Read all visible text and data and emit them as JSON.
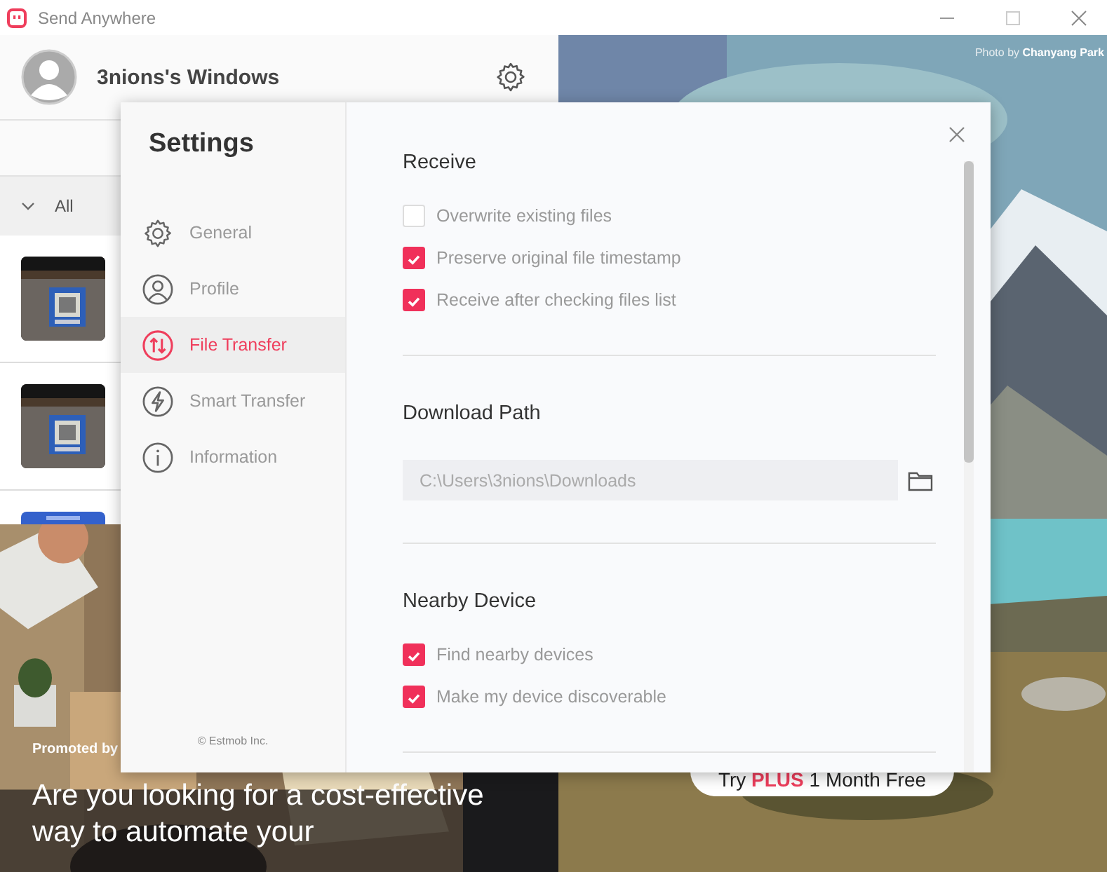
{
  "window": {
    "title": "Send Anywhere"
  },
  "profile": {
    "name": "3nions's Windows"
  },
  "filter": {
    "label": "All",
    "expanded": true
  },
  "ad": {
    "promoted": "Promoted by",
    "headline": "Are you looking for a cost-effective way to automate your"
  },
  "photo_credit": "Photo by **Chanyang Park**",
  "promo_button": [
    {
      "text": "Try",
      "highlight": false
    },
    {
      "text": "PLUS",
      "highlight": true
    },
    {
      "text": "1 Month Free",
      "highlight": false
    }
  ],
  "settings": {
    "title": "Settings",
    "menu": [
      {
        "kind": "general",
        "label": "General",
        "selected": false
      },
      {
        "kind": "profile",
        "label": "Profile",
        "selected": false
      },
      {
        "kind": "transfer",
        "label": "File Transfer",
        "selected": true
      },
      {
        "kind": "smart",
        "label": "Smart Transfer",
        "selected": false
      },
      {
        "kind": "info",
        "label": "Information",
        "selected": false
      }
    ],
    "copyright": "© Estmob Inc.",
    "sections": [
      {
        "kind": "checkboxes",
        "title": "Receive",
        "options": [
          {
            "label": "Overwrite existing files",
            "checked": false
          },
          {
            "label": "Preserve original file timestamp",
            "checked": true
          },
          {
            "label": "Receive after checking files list",
            "checked": true
          }
        ]
      },
      {
        "kind": "path",
        "title": "Download Path",
        "value": "C:\\Users\\3nions\\Downloads"
      },
      {
        "kind": "checkboxes",
        "title": "Nearby Device",
        "options": [
          {
            "label": "Find nearby devices",
            "checked": true
          },
          {
            "label": "Make my device discoverable",
            "checked": true
          }
        ]
      }
    ]
  }
}
